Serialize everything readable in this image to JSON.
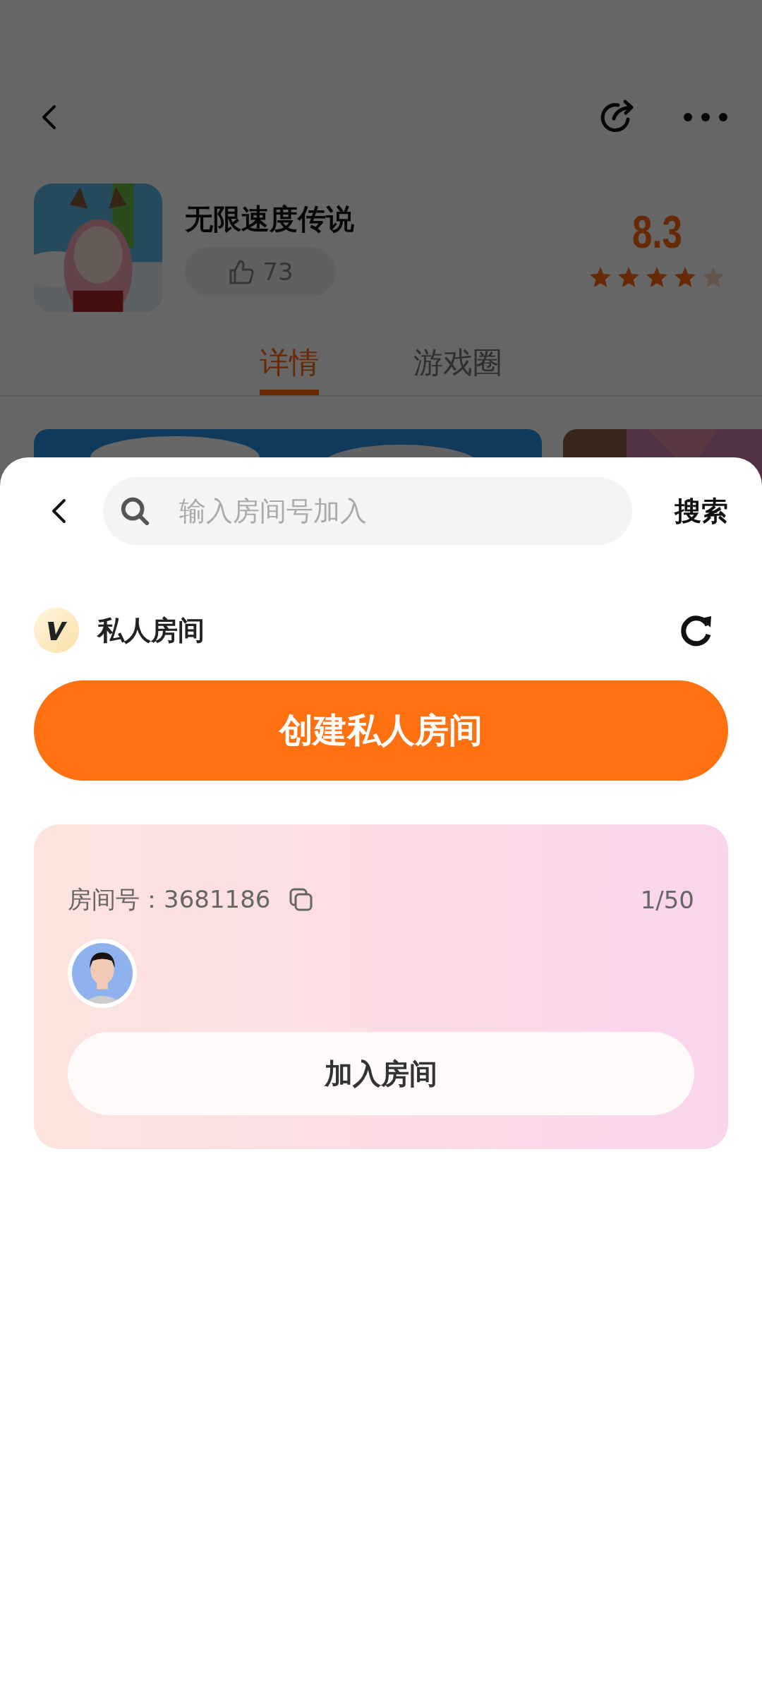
{
  "game": {
    "title": "无限速度传说",
    "likes": "73",
    "score": "8.3",
    "stars": 4
  },
  "tabs": [
    {
      "label": "详情",
      "selected": true
    },
    {
      "label": "游戏圈",
      "selected": false
    }
  ],
  "sheet": {
    "search": {
      "placeholder": "输入房间号加入"
    },
    "search_button": "搜索",
    "section_title": "私人房间",
    "create_button": "创建私人房间",
    "room": {
      "label": "房间号：3681186",
      "count": "1/50",
      "join_button": "加入房间"
    }
  }
}
